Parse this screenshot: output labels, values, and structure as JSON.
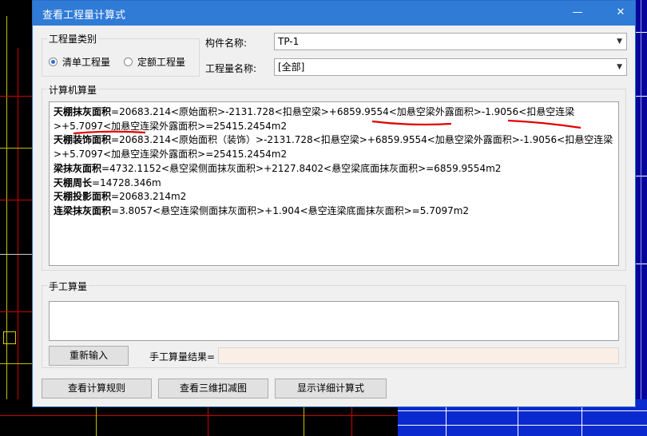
{
  "window": {
    "title": "查看工程量计算式",
    "minimize_glyph": "—",
    "close_glyph": "✕"
  },
  "category": {
    "title": "工程量类别",
    "options": [
      {
        "label": "清单工程量",
        "selected": true
      },
      {
        "label": "定额工程量",
        "selected": false
      }
    ]
  },
  "component": {
    "label": "构件名称:",
    "value": "TP-1"
  },
  "quantity": {
    "label": "工程量名称:",
    "value": "[全部]"
  },
  "computer": {
    "title": "计算机算量",
    "lines": [
      {
        "name": "天棚抹灰面积",
        "expr": "=20683.214<原始面积>-2131.728<扣悬空梁>+6859.9554<加悬空梁外露面积>-1.9056<扣悬空连梁>+5.7097<加悬空连梁外露面积>=25415.2454m2"
      },
      {
        "name": "天棚装饰面积",
        "expr": "=20683.214<原始面积（装饰）>-2131.728<扣悬空梁>+6859.9554<加悬空梁外露面积>-1.9056<扣悬空连梁>+5.7097<加悬空连梁外露面积>=25415.2454m2"
      },
      {
        "name": "梁抹灰面积",
        "expr": "=4732.1152<悬空梁侧面抹灰面积>+2127.8402<悬空梁底面抹灰面积>=6859.9554m2"
      },
      {
        "name": "天棚周长",
        "expr": "=14728.346m"
      },
      {
        "name": "天棚投影面积",
        "expr": "=20683.214m2"
      },
      {
        "name": "连梁抹灰面积",
        "expr": "=3.8057<悬空连梁侧面抹灰面积>+1.904<悬空连梁底面抹灰面积>=5.7097m2"
      }
    ]
  },
  "manual": {
    "title": "手工算量",
    "reenter_label": "重新输入",
    "result_label": "手工算量结果=",
    "result_value": ""
  },
  "footer": {
    "view_rules_label": "查看计算规则",
    "view_3d_label": "查看三维扣减图",
    "show_detail_label": "显示详细计算式"
  },
  "colors": {
    "titlebar": "#2f7bd6",
    "annotation": "#e00000"
  }
}
